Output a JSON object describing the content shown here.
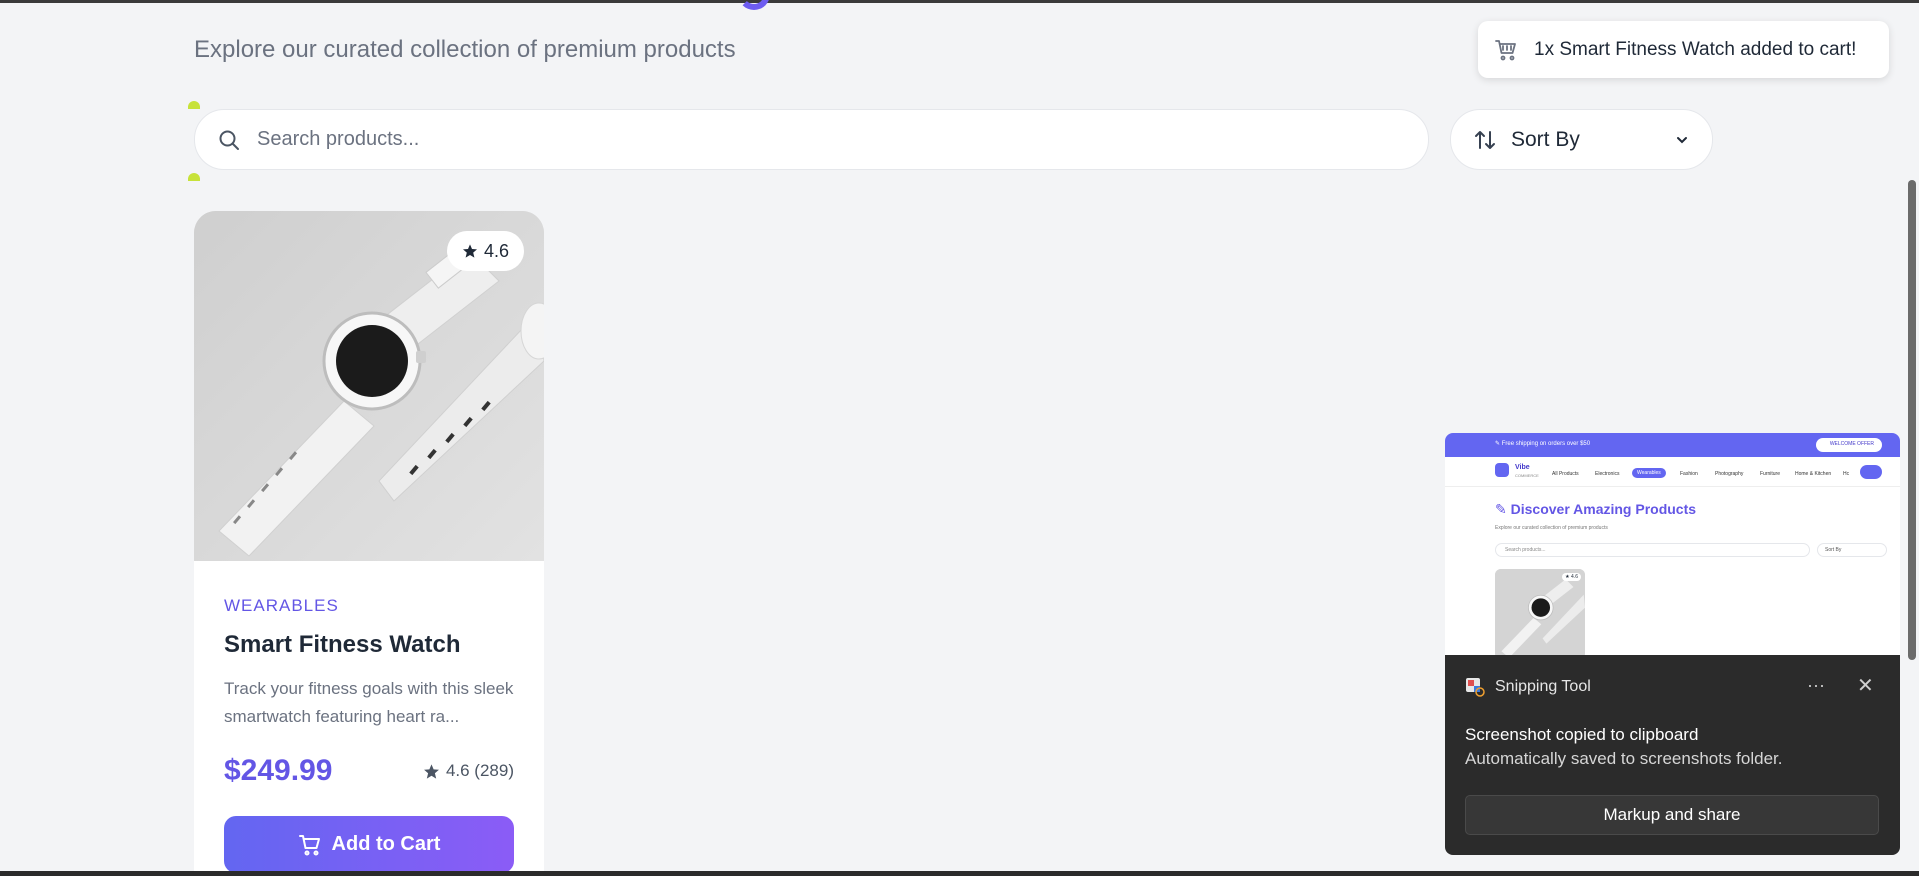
{
  "page": {
    "subtitle": "Explore our curated collection of premium products"
  },
  "search": {
    "placeholder": "Search products..."
  },
  "sort": {
    "label": "Sort By"
  },
  "toast": {
    "message": "1x Smart Fitness Watch added to cart!",
    "icon": "cart-icon"
  },
  "product": {
    "rating_badge": "4.6",
    "category": "WEARABLES",
    "name": "Smart Fitness Watch",
    "description": "Track your fitness goals with this sleek smartwatch featuring heart ra...",
    "price": "$249.99",
    "rating_summary": "4.6 (289)",
    "add_to_cart_label": "Add to Cart"
  },
  "snipping_notification": {
    "app_name": "Snipping Tool",
    "more_label": "···",
    "close_label": "✕",
    "message_title": "Screenshot copied to clipboard",
    "message_body": "Automatically saved to screenshots folder.",
    "action_label": "Markup and share"
  },
  "thumbnail": {
    "banner_text": "✎ Free shipping on orders over $50",
    "pill_text": "WELCOME OFFER",
    "logo_title": "Vibe",
    "logo_subtitle": "COMMERCE",
    "nav_items": [
      "All Products",
      "Electronics",
      "Wearables",
      "Fashion",
      "Photography",
      "Furniture",
      "Home & Kitchen",
      "Hc"
    ],
    "heading": "✎ Discover Amazing Products",
    "subheading": "Explore our curated collection of premium products",
    "search_placeholder": "Search products...",
    "sort_label": "Sort By",
    "rating": "★ 4.6"
  },
  "colors": {
    "accent": "#6356e5",
    "button_gradient_start": "#6366f1",
    "button_gradient_end": "#8b5cf6",
    "background": "#f3f4f6",
    "notification_bg": "#2b2b2b"
  }
}
